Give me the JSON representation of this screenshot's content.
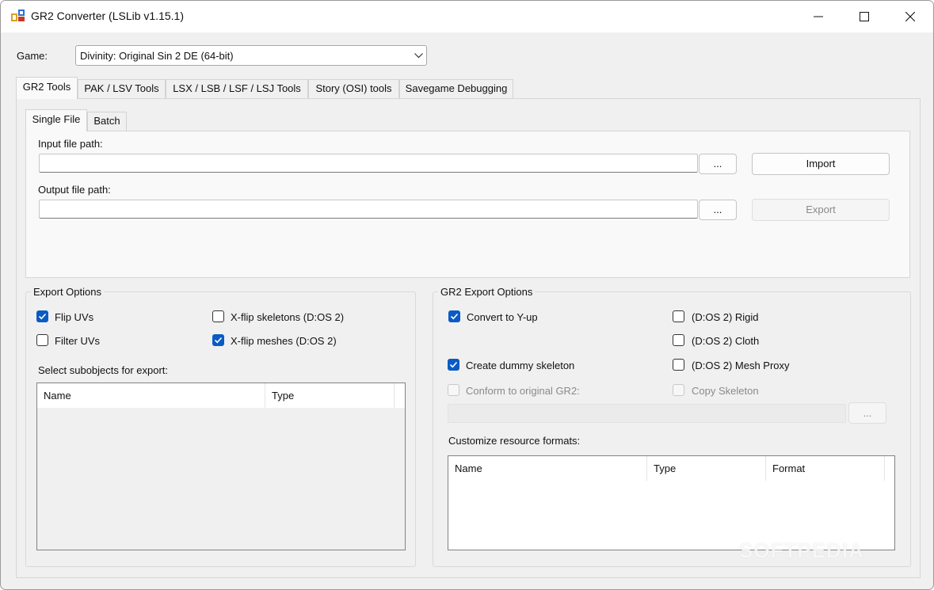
{
  "window": {
    "title": "GR2 Converter (LSLib v1.15.1)",
    "controls": {
      "minimize": "—",
      "maximize": "☐",
      "close": "✕"
    }
  },
  "game": {
    "label": "Game:",
    "selected": "Divinity: Original Sin 2 DE (64-bit)"
  },
  "main_tabs": [
    "GR2 Tools",
    "PAK / LSV Tools",
    "LSX / LSB / LSF / LSJ Tools",
    "Story (OSI) tools",
    "Savegame Debugging"
  ],
  "sub_tabs": [
    "Single File",
    "Batch"
  ],
  "single_file": {
    "input_label": "Input file path:",
    "input_value": "",
    "output_label": "Output file path:",
    "output_value": "",
    "browse_label": "...",
    "import_label": "Import",
    "export_label": "Export"
  },
  "export_options": {
    "title": "Export Options",
    "flip_uvs": {
      "label": "Flip UVs",
      "checked": true
    },
    "filter_uvs": {
      "label": "Filter UVs",
      "checked": false
    },
    "xflip_skeletons": {
      "label": "X-flip skeletons (D:OS 2)",
      "checked": false
    },
    "xflip_meshes": {
      "label": "X-flip meshes (D:OS 2)",
      "checked": true
    },
    "subobjects_label": "Select subobjects for export:",
    "columns": [
      "Name",
      "Type"
    ]
  },
  "gr2_export_options": {
    "title": "GR2 Export Options",
    "convert_yup": {
      "label": "Convert to Y-up",
      "checked": true
    },
    "rigid": {
      "label": "(D:OS 2) Rigid",
      "checked": false
    },
    "cloth": {
      "label": "(D:OS 2) Cloth",
      "checked": false
    },
    "dummy_skeleton": {
      "label": "Create dummy skeleton",
      "checked": true
    },
    "mesh_proxy": {
      "label": "(D:OS 2) Mesh Proxy",
      "checked": false
    },
    "conform": {
      "label": "Conform to original GR2:",
      "checked": false,
      "enabled": false
    },
    "copy_skeleton": {
      "label": "Copy Skeleton",
      "checked": false,
      "enabled": false
    },
    "conform_path": "",
    "browse_label": "...",
    "formats_label": "Customize resource formats:",
    "columns": [
      "Name",
      "Type",
      "Format"
    ]
  },
  "watermark": "SOFTPEDIA",
  "colors": {
    "accent": "#0a5bc4",
    "window_bg": "#f0f0f0",
    "panel_bg": "#f9f9f9"
  }
}
